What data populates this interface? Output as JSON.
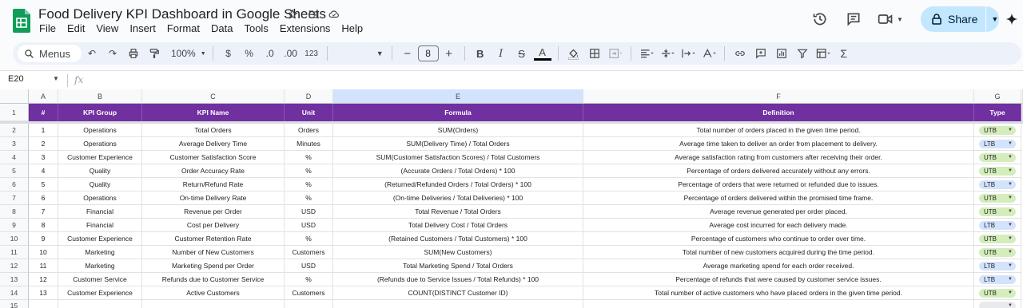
{
  "header": {
    "title": "Food Delivery KPI Dashboard in Google Sheets",
    "menu": [
      "File",
      "Edit",
      "View",
      "Insert",
      "Format",
      "Data",
      "Tools",
      "Extensions",
      "Help"
    ],
    "share_label": "Share"
  },
  "toolbar": {
    "menus_label": "Menus",
    "zoom": "100%",
    "currency": "$",
    "percent": "%",
    "dec_decrease": ".0",
    "dec_increase": ".00",
    "number_format": "123",
    "font_size": "8",
    "bold": "B"
  },
  "formula_bar": {
    "name_box": "E20",
    "fx": "fx"
  },
  "columns": [
    "A",
    "B",
    "C",
    "D",
    "E",
    "F",
    "G"
  ],
  "selected_column": "E",
  "header_row": [
    "#",
    "KPI Group",
    "KPI Name",
    "Unit",
    "Formula",
    "Definition",
    "Type"
  ],
  "rows": [
    [
      "1",
      "Operations",
      "Total Orders",
      "Orders",
      "SUM(Orders)",
      "Total number of orders placed in the given time period.",
      "UTB"
    ],
    [
      "2",
      "Operations",
      "Average Delivery Time",
      "Minutes",
      "SUM(Delivery Time) / Total Orders",
      "Average time taken to deliver an order from placement to delivery.",
      "LTB"
    ],
    [
      "3",
      "Customer Experience",
      "Customer Satisfaction Score",
      "%",
      "SUM(Customer Satisfaction Scores) / Total Customers",
      "Average satisfaction rating from customers after receiving their order.",
      "UTB"
    ],
    [
      "4",
      "Quality",
      "Order Accuracy Rate",
      "%",
      "(Accurate Orders / Total Orders) * 100",
      "Percentage of orders delivered accurately without any errors.",
      "UTB"
    ],
    [
      "5",
      "Quality",
      "Return/Refund Rate",
      "%",
      "(Returned/Refunded Orders / Total Orders) * 100",
      "Percentage of orders that were returned or refunded due to issues.",
      "LTB"
    ],
    [
      "6",
      "Operations",
      "On-time Delivery Rate",
      "%",
      "(On-time Deliveries / Total Deliveries) * 100",
      "Percentage of orders delivered within the promised time frame.",
      "UTB"
    ],
    [
      "7",
      "Financial",
      "Revenue per Order",
      "USD",
      "Total Revenue / Total Orders",
      "Average revenue generated per order placed.",
      "UTB"
    ],
    [
      "8",
      "Financial",
      "Cost per Delivery",
      "USD",
      "Total Delivery Cost / Total Orders",
      "Average cost incurred for each delivery made.",
      "LTB"
    ],
    [
      "9",
      "Customer Experience",
      "Customer Retention Rate",
      "%",
      "(Retained Customers / Total Customers) * 100",
      "Percentage of customers who continue to order over time.",
      "UTB"
    ],
    [
      "10",
      "Marketing",
      "Number of New Customers",
      "Customers",
      "SUM(New Customers)",
      "Total number of new customers acquired during the time period.",
      "UTB"
    ],
    [
      "11",
      "Marketing",
      "Marketing Spend per Order",
      "USD",
      "Total Marketing Spend / Total Orders",
      "Average marketing spend for each order received.",
      "LTB"
    ],
    [
      "12",
      "Customer Service",
      "Refunds due to Customer Service",
      "%",
      "(Refunds due to Service Issues / Total Refunds) * 100",
      "Percentage of refunds that were caused by customer service issues.",
      "LTB"
    ],
    [
      "13",
      "Customer Experience",
      "Active Customers",
      "Customers",
      "COUNT(DISTINCT Customer ID)",
      "Total number of active customers who have placed orders in the given time period.",
      "UTB"
    ]
  ],
  "row_numbers": [
    "1",
    "2",
    "3",
    "4",
    "5",
    "6",
    "7",
    "8",
    "9",
    "10",
    "11",
    "12",
    "13",
    "14",
    "15"
  ],
  "colors": {
    "header_fill": "#7030a0",
    "utb_chip": "#d4edbc",
    "ltb_chip": "#d3e3fd",
    "share_button": "#c2e7ff"
  }
}
